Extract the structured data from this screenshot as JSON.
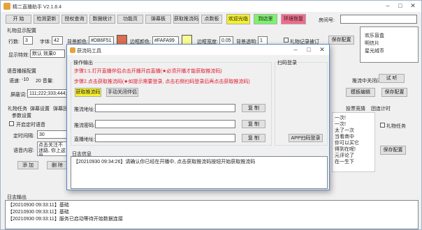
{
  "app": {
    "title": "精二直播助手 V2.1.8.4"
  },
  "toolbar": {
    "start": "开 始",
    "check_update": "检测更新",
    "auth_query": "授权查询",
    "data_stats": "数据统计",
    "func_page": "功能页",
    "danmaku": "弹幕板",
    "get_stream": "获取推流码",
    "points": "点数板",
    "welcome": "欢迎光临",
    "arrive": "到店里",
    "loop_play": "环境恢复",
    "room_label": "房间号:"
  },
  "gift_section": {
    "title": "礼物显示配置",
    "rows_label": "行数:",
    "rows_value": "3",
    "font_label": "字体:",
    "font_value": "42",
    "bg_color_label": "背景颜色:",
    "bg_color_value": "#DB6F51",
    "border_color_label": "边框颜色:",
    "border_color_value": "#FAFA99",
    "border_width_label": "边框宽度:",
    "border_width_value": "0.05",
    "bg_alpha_label": "背景透明:",
    "bg_alpha_value": "1",
    "record_label": "礼物记录被订",
    "save": "保存配置",
    "display_mode_label": "显示特效:",
    "display_mode_value": "默认 效果0",
    "side_list": [
      "欢乐盲盒",
      "明信片",
      "星光绒币"
    ]
  },
  "voice_section": {
    "title": "语音播报配置",
    "speed_label": "语速:",
    "speed_min": "-10",
    "volume_label": "20 音量:",
    "screen_label": "屏蔽词:",
    "screen_value": "111;222;333;444;5",
    "right_label": "推流中关闭闪",
    "test": "试 听",
    "template": "模板编辑",
    "save": "保存配置"
  },
  "tabs": [
    "礼物任务",
    "弹幕设置",
    "弹幕回复",
    "投票竞猜",
    "团连计时"
  ],
  "params": {
    "title": "参数设置",
    "timer_check": "开启定时语音",
    "interval_label": "定时间隔:",
    "interval_value": "30",
    "content_label": "语音内容:",
    "content_value": "点击关注不迷路, 你上这里",
    "add": "添 加",
    "delete": "删 除"
  },
  "right_panel": {
    "lines": [
      "一次!",
      "一次!",
      "太了一次",
      "当看商中",
      "你可以买它",
      "得到在呢!",
      "元评论了",
      "在一生下"
    ],
    "gift_task": "礼物任务",
    "save": "保存配置"
  },
  "log": {
    "title": "日志输出",
    "lines": [
      "【20210930 09:33:11】基础",
      "【20210930 09:33:11】基础",
      "【20210930 09:33:11】服务已启动等待开始数据连接"
    ]
  },
  "dialog": {
    "title": "获流码工具",
    "ops_title": "操作输出",
    "step1": "步骤1:1.打开直播伴侣点击开播开启直播(★必须开播才能获取推流码)",
    "step2": "步骤2.点击获取推流码(★如提示需要登录, 点击右侧扫码登录后再点击获取推流码)",
    "get_btn": "获取推流码",
    "manual_btn": "手动关闭伴侣",
    "scan_title": "扫码登录",
    "addr_label": "推流地址:",
    "key_label": "推流密码:",
    "live_label": "直播地址:",
    "copy": "复 制",
    "app_scan": "APP扫码登录",
    "log_title": "日志信息",
    "log_line": "【20210930 09:34:26】请确认你已经在开播中, 点击获取推流码按钮开始获取推流码"
  },
  "colors": {
    "bg_swatch": "#DB6F51",
    "border_swatch": "#FAFA99",
    "welcome": "#f5f02a",
    "arrive": "#7cf26d",
    "loop": "#f06b8a",
    "get_btn_bg": "#f5f02a"
  }
}
